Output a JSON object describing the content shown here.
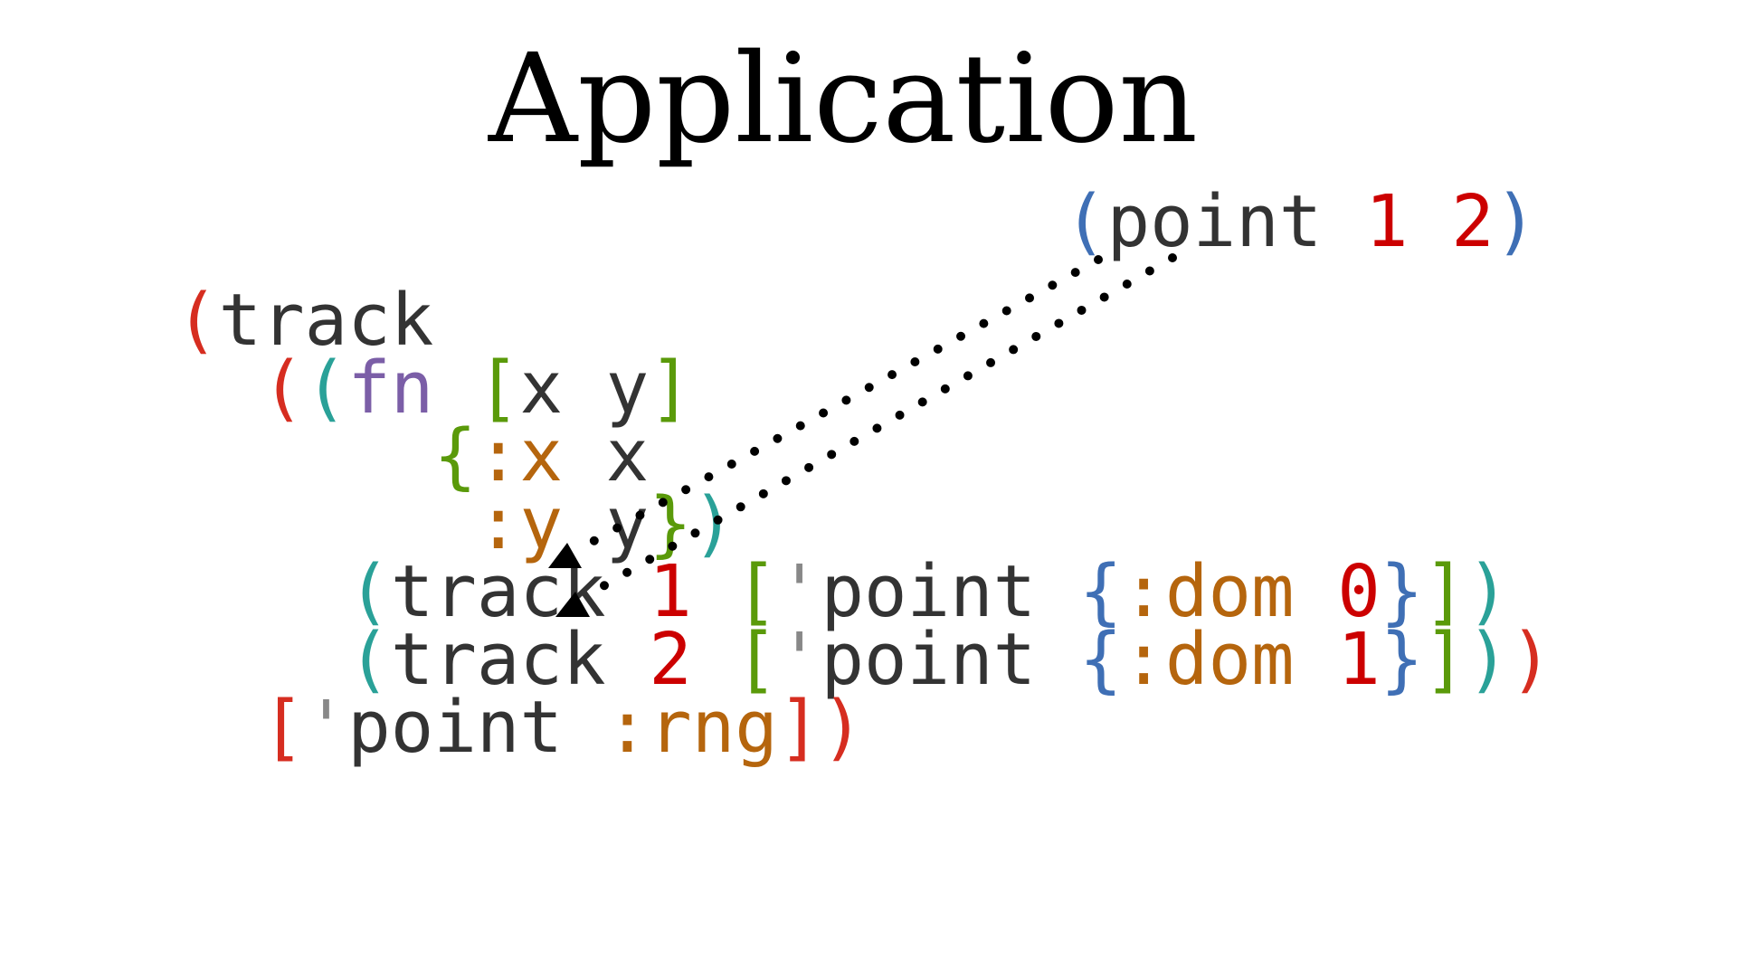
{
  "title": "Application",
  "colors": {
    "text": "#333333",
    "red": "#d62d20",
    "number": "#cc0000",
    "teal": "#2aa198",
    "purple": "#7b5ea7",
    "green": "#5a9a0a",
    "keyword": "#b5650d",
    "blue": "#3f6fb5",
    "grey": "#888888",
    "arrow": "#000000"
  },
  "call": [
    {
      "t": "(",
      "c": "blue"
    },
    {
      "t": "point",
      "c": "text"
    },
    {
      "t": " ",
      "c": "text"
    },
    {
      "t": "1",
      "c": "number"
    },
    {
      "t": " ",
      "c": "text"
    },
    {
      "t": "2",
      "c": "number"
    },
    {
      "t": ")",
      "c": "blue"
    }
  ],
  "code_lines": [
    [
      {
        "t": "(",
        "c": "red"
      },
      {
        "t": "track",
        "c": "text"
      }
    ],
    [
      {
        "t": "  ",
        "c": "text"
      },
      {
        "t": "(",
        "c": "red"
      },
      {
        "t": "(",
        "c": "teal"
      },
      {
        "t": "fn",
        "c": "purple"
      },
      {
        "t": " ",
        "c": "text"
      },
      {
        "t": "[",
        "c": "green"
      },
      {
        "t": "x",
        "c": "text"
      },
      {
        "t": " ",
        "c": "text"
      },
      {
        "t": "y",
        "c": "text"
      },
      {
        "t": "]",
        "c": "green"
      }
    ],
    [
      {
        "t": "      ",
        "c": "text"
      },
      {
        "t": "{",
        "c": "green"
      },
      {
        "t": ":x",
        "c": "keyword"
      },
      {
        "t": " ",
        "c": "text"
      },
      {
        "t": "x",
        "c": "text"
      }
    ],
    [
      {
        "t": "       ",
        "c": "text"
      },
      {
        "t": ":y",
        "c": "keyword"
      },
      {
        "t": " ",
        "c": "text"
      },
      {
        "t": "y",
        "c": "text"
      },
      {
        "t": "}",
        "c": "green"
      },
      {
        "t": ")",
        "c": "teal"
      }
    ],
    [
      {
        "t": "    ",
        "c": "text"
      },
      {
        "t": "(",
        "c": "teal"
      },
      {
        "t": "track",
        "c": "text"
      },
      {
        "t": " ",
        "c": "text"
      },
      {
        "t": "1",
        "c": "number"
      },
      {
        "t": " ",
        "c": "text"
      },
      {
        "t": "[",
        "c": "green"
      },
      {
        "t": "'",
        "c": "grey"
      },
      {
        "t": "point",
        "c": "text"
      },
      {
        "t": " ",
        "c": "text"
      },
      {
        "t": "{",
        "c": "blue"
      },
      {
        "t": ":dom",
        "c": "keyword"
      },
      {
        "t": " ",
        "c": "text"
      },
      {
        "t": "0",
        "c": "number"
      },
      {
        "t": "}",
        "c": "blue"
      },
      {
        "t": "]",
        "c": "green"
      },
      {
        "t": ")",
        "c": "teal"
      }
    ],
    [
      {
        "t": "    ",
        "c": "text"
      },
      {
        "t": "(",
        "c": "teal"
      },
      {
        "t": "track",
        "c": "text"
      },
      {
        "t": " ",
        "c": "text"
      },
      {
        "t": "2",
        "c": "number"
      },
      {
        "t": " ",
        "c": "text"
      },
      {
        "t": "[",
        "c": "green"
      },
      {
        "t": "'",
        "c": "grey"
      },
      {
        "t": "point",
        "c": "text"
      },
      {
        "t": " ",
        "c": "text"
      },
      {
        "t": "{",
        "c": "blue"
      },
      {
        "t": ":dom",
        "c": "keyword"
      },
      {
        "t": " ",
        "c": "text"
      },
      {
        "t": "1",
        "c": "number"
      },
      {
        "t": "}",
        "c": "blue"
      },
      {
        "t": "]",
        "c": "green"
      },
      {
        "t": ")",
        "c": "teal"
      },
      {
        "t": ")",
        "c": "red"
      }
    ],
    [
      {
        "t": "  ",
        "c": "text"
      },
      {
        "t": "[",
        "c": "red"
      },
      {
        "t": "'",
        "c": "grey"
      },
      {
        "t": "point",
        "c": "text"
      },
      {
        "t": " ",
        "c": "text"
      },
      {
        "t": ":rng",
        "c": "keyword"
      },
      {
        "t": "]",
        "c": "red"
      },
      {
        "t": ")",
        "c": "red"
      }
    ]
  ]
}
